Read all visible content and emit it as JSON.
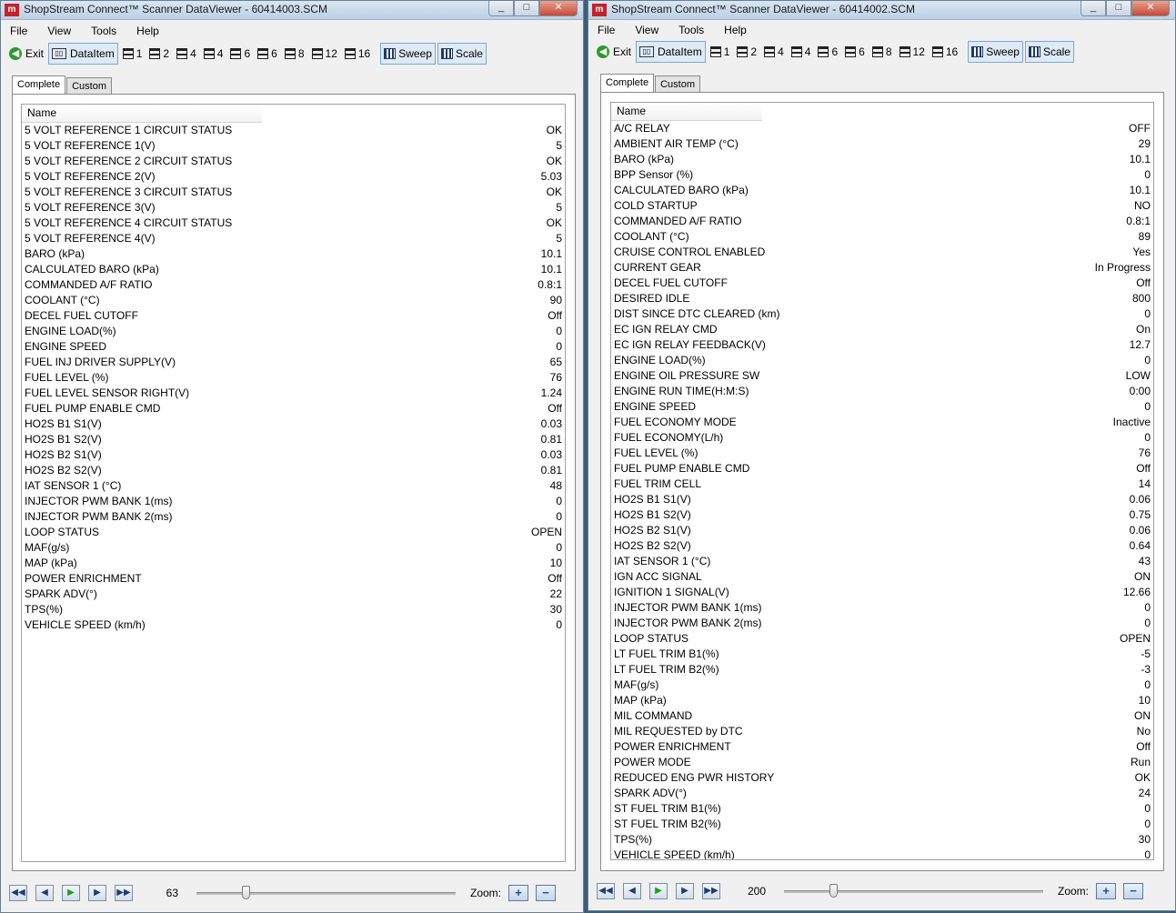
{
  "windows": [
    {
      "title": "ShopStream Connect™ Scanner DataViewer - 60414003.SCM",
      "menu": [
        "File",
        "View",
        "Tools",
        "Help"
      ],
      "toolbar": {
        "exit": "Exit",
        "dataitem": "DataItem",
        "layouts": [
          "1",
          "2",
          "4",
          "4",
          "6",
          "6",
          "8",
          "12",
          "16"
        ],
        "sweep": "Sweep",
        "scale": "Scale"
      },
      "tabs": [
        "Complete",
        "Custom"
      ],
      "column_name": "Name",
      "rows": [
        [
          "5 VOLT REFERENCE 1 CIRCUIT STATUS",
          "OK"
        ],
        [
          "5 VOLT REFERENCE 1(V)",
          "5"
        ],
        [
          "5 VOLT REFERENCE 2 CIRCUIT STATUS",
          "OK"
        ],
        [
          "5 VOLT REFERENCE 2(V)",
          "5.03"
        ],
        [
          "5 VOLT REFERENCE 3 CIRCUIT STATUS",
          "OK"
        ],
        [
          "5 VOLT REFERENCE 3(V)",
          "5"
        ],
        [
          "5 VOLT REFERENCE 4 CIRCUIT STATUS",
          "OK"
        ],
        [
          "5 VOLT REFERENCE 4(V)",
          "5"
        ],
        [
          "BARO (kPa)",
          "10.1"
        ],
        [
          "CALCULATED BARO (kPa)",
          "10.1"
        ],
        [
          "COMMANDED A/F RATIO",
          "0.8:1"
        ],
        [
          "COOLANT (°C)",
          "90"
        ],
        [
          "DECEL FUEL CUTOFF",
          "Off"
        ],
        [
          "ENGINE LOAD(%)",
          "0"
        ],
        [
          "ENGINE SPEED",
          "0"
        ],
        [
          "FUEL INJ DRIVER SUPPLY(V)",
          "65"
        ],
        [
          "FUEL LEVEL (%)",
          "76"
        ],
        [
          "FUEL LEVEL SENSOR RIGHT(V)",
          "1.24"
        ],
        [
          "FUEL PUMP ENABLE CMD",
          "Off"
        ],
        [
          "HO2S B1 S1(V)",
          "0.03"
        ],
        [
          "HO2S B1 S2(V)",
          "0.81"
        ],
        [
          "HO2S B2 S1(V)",
          "0.03"
        ],
        [
          "HO2S B2 S2(V)",
          "0.81"
        ],
        [
          "IAT SENSOR 1 (°C)",
          "48"
        ],
        [
          "INJECTOR PWM BANK 1(ms)",
          "0"
        ],
        [
          "INJECTOR PWM BANK 2(ms)",
          "0"
        ],
        [
          "LOOP STATUS",
          "OPEN"
        ],
        [
          "MAF(g/s)",
          "0"
        ],
        [
          "MAP (kPa)",
          "10"
        ],
        [
          "POWER ENRICHMENT",
          "Off"
        ],
        [
          "SPARK ADV(°)",
          "22"
        ],
        [
          "TPS(%)",
          "30"
        ],
        [
          "VEHICLE SPEED (km/h)",
          "0"
        ]
      ],
      "sweep_value": "63",
      "slider_level": 0.18,
      "zoom_label": "Zoom:"
    },
    {
      "title": "ShopStream Connect™ Scanner DataViewer - 60414002.SCM",
      "menu": [
        "File",
        "View",
        "Tools",
        "Help"
      ],
      "toolbar": {
        "exit": "Exit",
        "dataitem": "DataItem",
        "layouts": [
          "1",
          "2",
          "4",
          "4",
          "6",
          "6",
          "8",
          "12",
          "16"
        ],
        "sweep": "Sweep",
        "scale": "Scale"
      },
      "tabs": [
        "Complete",
        "Custom"
      ],
      "column_name": "Name",
      "rows": [
        [
          "A/C RELAY",
          "OFF"
        ],
        [
          "AMBIENT AIR TEMP (°C)",
          "29"
        ],
        [
          "BARO (kPa)",
          "10.1"
        ],
        [
          "BPP Sensor (%)",
          "0"
        ],
        [
          "CALCULATED BARO (kPa)",
          "10.1"
        ],
        [
          "COLD STARTUP",
          "NO"
        ],
        [
          "COMMANDED A/F RATIO",
          "0.8:1"
        ],
        [
          "COOLANT (°C)",
          "89"
        ],
        [
          "CRUISE CONTROL ENABLED",
          "Yes"
        ],
        [
          "CURRENT GEAR",
          "In Progress"
        ],
        [
          "DECEL FUEL CUTOFF",
          "Off"
        ],
        [
          "DESIRED IDLE",
          "800"
        ],
        [
          "DIST SINCE DTC CLEARED (km)",
          "0"
        ],
        [
          "EC IGN RELAY CMD",
          "On"
        ],
        [
          "EC IGN RELAY FEEDBACK(V)",
          "12.7"
        ],
        [
          "ENGINE LOAD(%)",
          "0"
        ],
        [
          "ENGINE OIL PRESSURE SW",
          "LOW"
        ],
        [
          "ENGINE RUN TIME(H:M:S)",
          "0:00"
        ],
        [
          "ENGINE SPEED",
          "0"
        ],
        [
          "FUEL ECONOMY MODE",
          "Inactive"
        ],
        [
          "FUEL ECONOMY(L/h)",
          "0"
        ],
        [
          "FUEL LEVEL (%)",
          "76"
        ],
        [
          "FUEL PUMP ENABLE CMD",
          "Off"
        ],
        [
          "FUEL TRIM CELL",
          "14"
        ],
        [
          "HO2S B1 S1(V)",
          "0.06"
        ],
        [
          "HO2S B1 S2(V)",
          "0.75"
        ],
        [
          "HO2S B2 S1(V)",
          "0.06"
        ],
        [
          "HO2S B2 S2(V)",
          "0.64"
        ],
        [
          "IAT SENSOR 1 (°C)",
          "43"
        ],
        [
          "IGN ACC SIGNAL",
          "ON"
        ],
        [
          "IGNITION 1 SIGNAL(V)",
          "12.66"
        ],
        [
          "INJECTOR PWM BANK 1(ms)",
          "0"
        ],
        [
          "INJECTOR PWM BANK 2(ms)",
          "0"
        ],
        [
          "LOOP STATUS",
          "OPEN"
        ],
        [
          "LT FUEL TRIM B1(%)",
          "-5"
        ],
        [
          "LT FUEL TRIM B2(%)",
          "-3"
        ],
        [
          "MAF(g/s)",
          "0"
        ],
        [
          "MAP (kPa)",
          "10"
        ],
        [
          "MIL COMMAND",
          "ON"
        ],
        [
          "MIL REQUESTED by DTC",
          "No"
        ],
        [
          "POWER ENRICHMENT",
          "Off"
        ],
        [
          "POWER MODE",
          "Run"
        ],
        [
          "REDUCED ENG PWR HISTORY",
          "OK"
        ],
        [
          "SPARK ADV(°)",
          "24"
        ],
        [
          "ST FUEL TRIM B1(%)",
          "0"
        ],
        [
          "ST FUEL TRIM B2(%)",
          "0"
        ],
        [
          "TPS(%)",
          "30"
        ],
        [
          "VEHICLE SPEED (km/h)",
          "0"
        ]
      ],
      "sweep_value": "200",
      "slider_level": 0.18,
      "zoom_label": "Zoom:"
    }
  ]
}
